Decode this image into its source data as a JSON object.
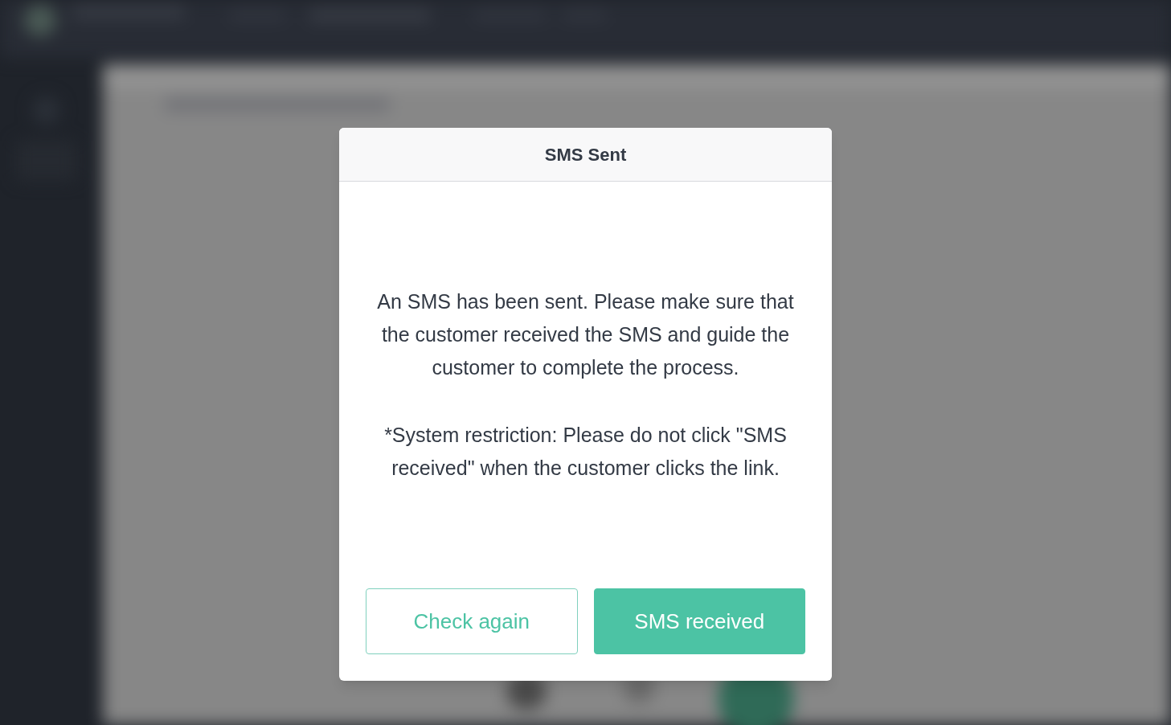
{
  "dialog": {
    "title": "SMS Sent",
    "paragraphs": [
      "An SMS has been sent. Please make sure that the customer received the SMS and guide the customer to complete the process.",
      "*System restriction: Please do not click \"SMS received\" when the customer clicks the link."
    ],
    "buttons": [
      {
        "label": "Check again",
        "kind": "outline"
      },
      {
        "label": "SMS received",
        "kind": "primary"
      }
    ]
  }
}
